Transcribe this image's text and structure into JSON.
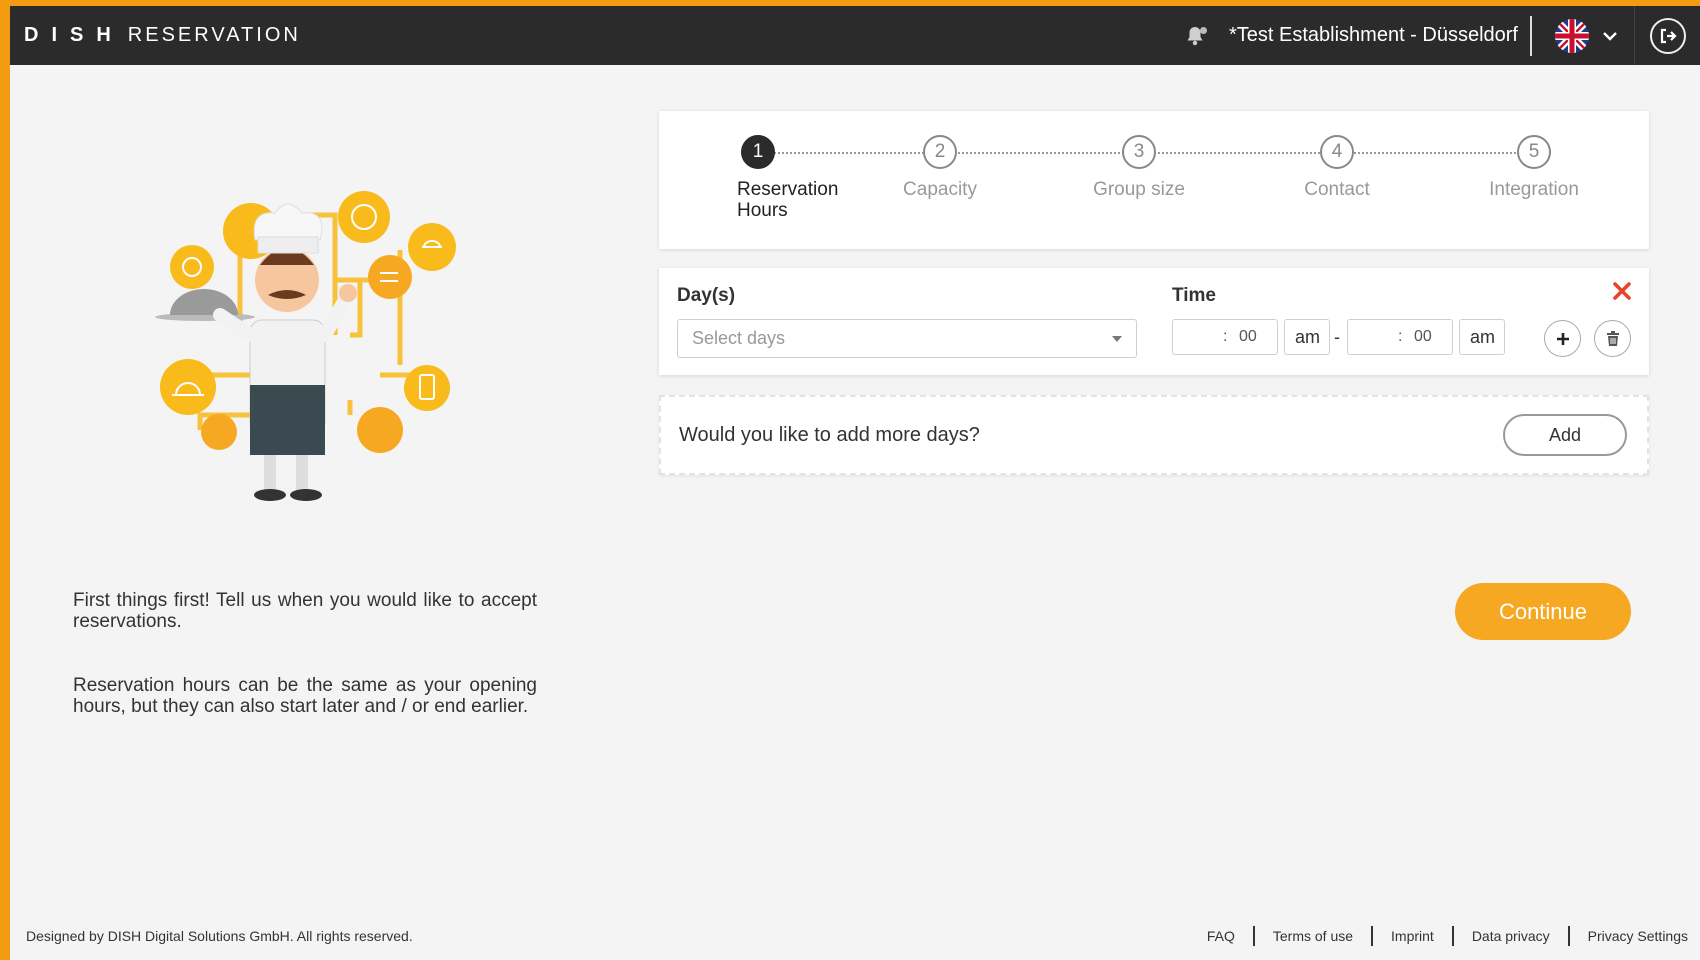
{
  "header": {
    "brand": "DISH",
    "product": "RESERVATION",
    "establishment": "*Test Establishment - Düsseldorf",
    "language_icon": "uk-flag-icon"
  },
  "steps": [
    {
      "number": "1",
      "label": "Reservation Hours"
    },
    {
      "number": "2",
      "label": "Capacity"
    },
    {
      "number": "3",
      "label": "Group size"
    },
    {
      "number": "4",
      "label": "Contact"
    },
    {
      "number": "5",
      "label": "Integration"
    }
  ],
  "active_step": 1,
  "left": {
    "paragraph1": "First things first! Tell us when you would like to accept reservations.",
    "paragraph2": "Reservation hours can be the same as your opening hours, but they can also start later and / or end earlier."
  },
  "hours": {
    "days_label": "Day(s)",
    "days_placeholder": "Select days",
    "time_label": "Time",
    "start_minutes": "00",
    "start_ampm": "am",
    "end_minutes": "00",
    "end_ampm": "am",
    "separator": "-"
  },
  "addmore": {
    "question": "Would you like to add more days?",
    "add_label": "Add"
  },
  "continue_label": "Continue",
  "footer": {
    "copyright": "Designed by DISH Digital Solutions GmbH. All rights reserved.",
    "links": [
      "FAQ",
      "Terms of use",
      "Imprint",
      "Data privacy",
      "Privacy Settings"
    ]
  },
  "colors": {
    "accent": "#f7a823",
    "frame": "#f39c12",
    "header_bg": "#2b2b2b",
    "close": "#e8442b"
  }
}
